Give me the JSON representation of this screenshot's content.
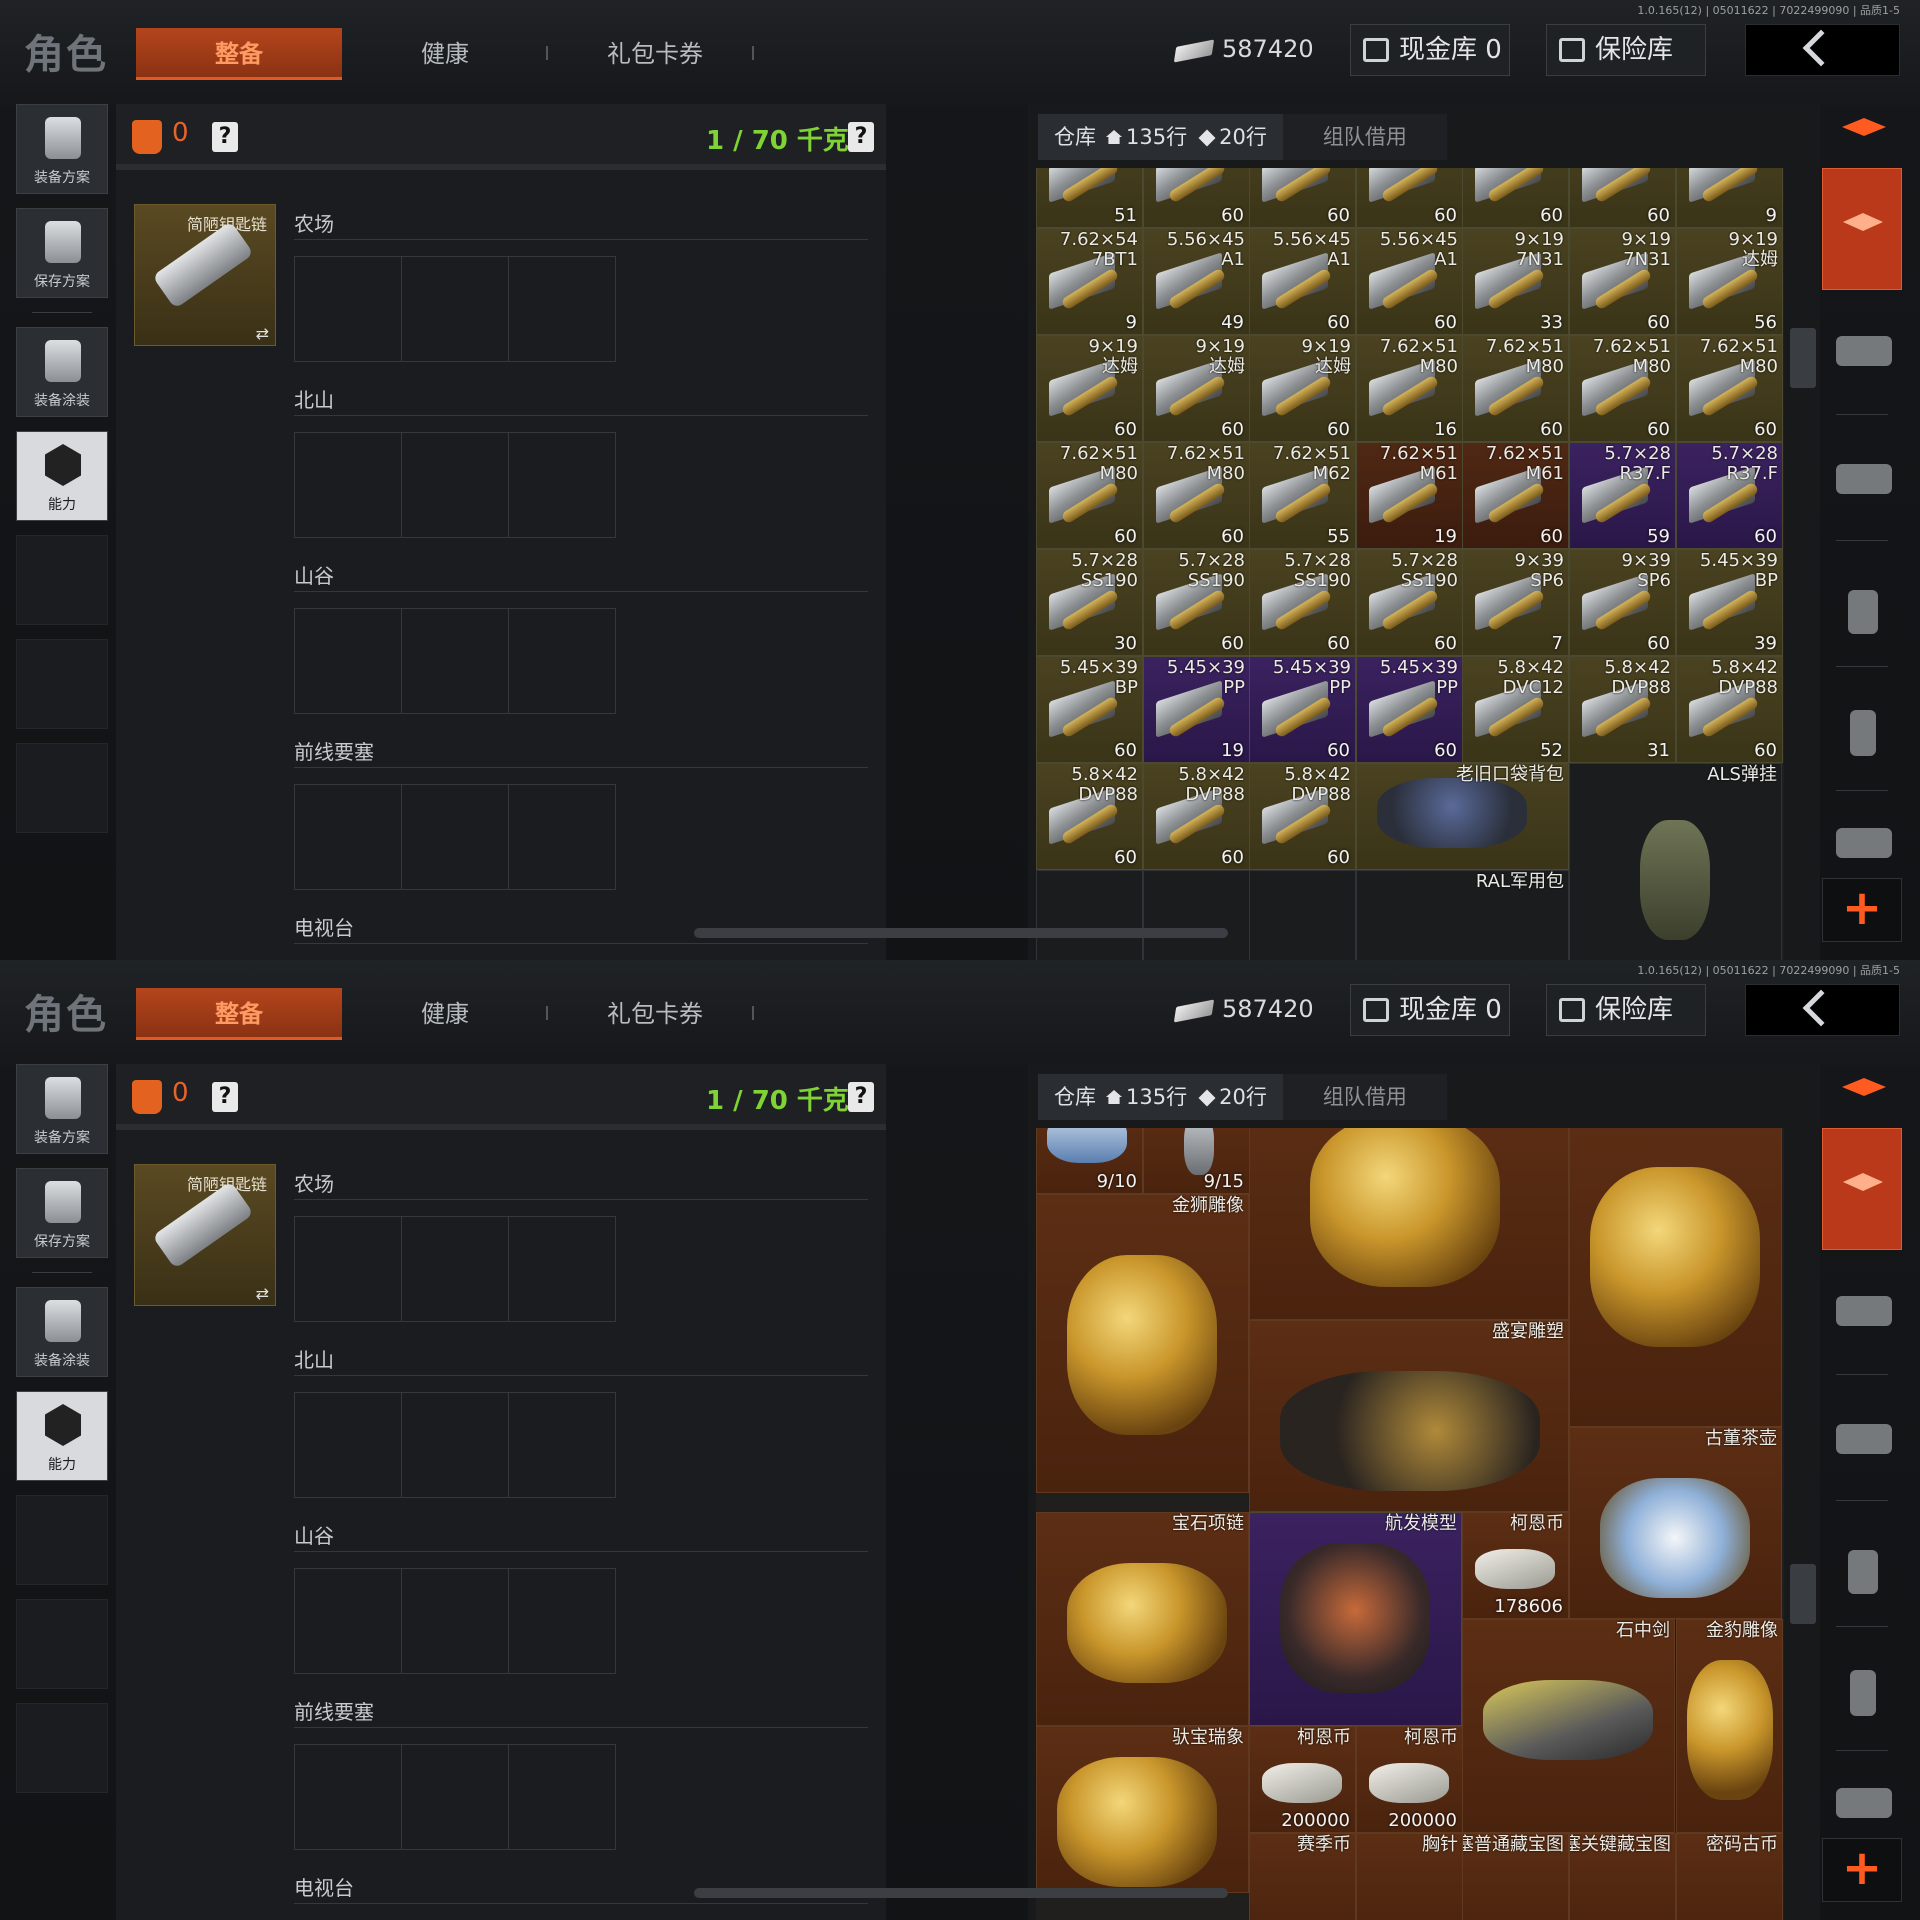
{
  "screens": [
    {
      "version": "1.0.165(12) | 05011622 | 7022499090 | 品质1-5",
      "header": {
        "title": "角色",
        "tabs": [
          "整备",
          "健康",
          "礼包卡券"
        ],
        "money": "587420",
        "cash_vault": "现金库 0",
        "vault": "保险库"
      },
      "left_sidebar": [
        "装备方案",
        "保存方案",
        "装备涂装",
        "能力"
      ],
      "loadout": {
        "armor_count": "0",
        "help": "?",
        "weight": "1 / 70 千克",
        "keychain_name": "简陋钥匙链",
        "sections": [
          "农场",
          "北山",
          "山谷",
          "前线要塞",
          "电视台"
        ]
      },
      "storage": {
        "tab_label": "仓库",
        "rows_home": "135行",
        "rows_gem": "20行",
        "team_tab": "组队借用",
        "cells": [
          {
            "name": "",
            "count": "51",
            "color": "g"
          },
          {
            "name": "",
            "count": "60",
            "color": "g"
          },
          {
            "name": "",
            "count": "60",
            "color": "g"
          },
          {
            "name": "",
            "count": "60",
            "color": "g"
          },
          {
            "name": "",
            "count": "60",
            "color": "g"
          },
          {
            "name": "",
            "count": "60",
            "color": "g"
          },
          {
            "name": "",
            "count": "9",
            "color": "g"
          },
          {
            "name": "7.62×54\n7BT1",
            "count": "9",
            "color": "g"
          },
          {
            "name": "5.56×45\nA1",
            "count": "49",
            "color": "g"
          },
          {
            "name": "5.56×45\nA1",
            "count": "60",
            "color": "g"
          },
          {
            "name": "5.56×45\nA1",
            "count": "60",
            "color": "g"
          },
          {
            "name": "9×19\n7N31",
            "count": "33",
            "color": "g"
          },
          {
            "name": "9×19\n7N31",
            "count": "60",
            "color": "g"
          },
          {
            "name": "9×19\n达姆",
            "count": "56",
            "color": "g"
          },
          {
            "name": "9×19\n达姆",
            "count": "60",
            "color": "g"
          },
          {
            "name": "9×19\n达姆",
            "count": "60",
            "color": "g"
          },
          {
            "name": "9×19\n达姆",
            "count": "60",
            "color": "g"
          },
          {
            "name": "7.62×51\nM80",
            "count": "16",
            "color": "g"
          },
          {
            "name": "7.62×51\nM80",
            "count": "60",
            "color": "g"
          },
          {
            "name": "7.62×51\nM80",
            "count": "60",
            "color": "g"
          },
          {
            "name": "7.62×51\nM80",
            "count": "60",
            "color": "g"
          },
          {
            "name": "7.62×51\nM80",
            "count": "60",
            "color": "g"
          },
          {
            "name": "7.62×51\nM80",
            "count": "60",
            "color": "g"
          },
          {
            "name": "7.62×51\nM62",
            "count": "55",
            "color": "g"
          },
          {
            "name": "7.62×51\nM61",
            "count": "19",
            "color": "r"
          },
          {
            "name": "7.62×51\nM61",
            "count": "60",
            "color": "r"
          },
          {
            "name": "5.7×28\nR37.F",
            "count": "59",
            "color": "p"
          },
          {
            "name": "5.7×28\nR37.F",
            "count": "60",
            "color": "p"
          },
          {
            "name": "5.7×28\nSS190",
            "count": "30",
            "color": "g"
          },
          {
            "name": "5.7×28\nSS190",
            "count": "60",
            "color": "g"
          },
          {
            "name": "5.7×28\nSS190",
            "count": "60",
            "color": "g"
          },
          {
            "name": "5.7×28\nSS190",
            "count": "60",
            "color": "g"
          },
          {
            "name": "9×39\nSP6",
            "count": "7",
            "color": "g"
          },
          {
            "name": "9×39\nSP6",
            "count": "60",
            "color": "g"
          },
          {
            "name": "5.45×39\nBP",
            "count": "39",
            "color": "g"
          },
          {
            "name": "5.45×39\nBP",
            "count": "60",
            "color": "g"
          },
          {
            "name": "5.45×39\nPP",
            "count": "19",
            "color": "p"
          },
          {
            "name": "5.45×39\nPP",
            "count": "60",
            "color": "p"
          },
          {
            "name": "5.45×39\nPP",
            "count": "60",
            "color": "p"
          },
          {
            "name": "5.8×42\nDVC12",
            "count": "52",
            "color": "g"
          },
          {
            "name": "5.8×42\nDVP88",
            "count": "31",
            "color": "g"
          },
          {
            "name": "5.8×42\nDVP88",
            "count": "60",
            "color": "g"
          },
          {
            "name": "5.8×42\nDVP88",
            "count": "60",
            "color": "g"
          },
          {
            "name": "5.8×42\nDVP88",
            "count": "60",
            "color": "g"
          },
          {
            "name": "5.8×42\nDVP88",
            "count": "60",
            "color": "g"
          },
          {
            "name": "老旧口袋背包",
            "count": "",
            "color": "g"
          },
          {
            "name": "ALS弹挂",
            "count": "",
            "color": "e"
          },
          {
            "name": "RAL军用包",
            "count": "",
            "color": "e"
          }
        ]
      }
    },
    {
      "version": "1.0.165(12) | 05011622 | 7022499090 | 品质1-5",
      "header": {
        "title": "角色",
        "tabs": [
          "整备",
          "健康",
          "礼包卡券"
        ],
        "money": "587420",
        "cash_vault": "现金库 0",
        "vault": "保险库"
      },
      "left_sidebar": [
        "装备方案",
        "保存方案",
        "装备涂装",
        "能力"
      ],
      "loadout": {
        "armor_count": "0",
        "help": "?",
        "weight": "1 / 70 千克",
        "keychain_name": "简陋钥匙链",
        "sections": [
          "农场",
          "北山",
          "山谷",
          "前线要塞",
          "电视台"
        ]
      },
      "storage": {
        "tab_label": "仓库",
        "rows_home": "135行",
        "rows_gem": "20行",
        "team_tab": "组队借用",
        "cells": [
          {
            "name": "",
            "count": "9/10",
            "color": "b"
          },
          {
            "name": "",
            "count": "9/15",
            "color": "b"
          },
          {
            "name": "",
            "count": "",
            "color": "b"
          },
          {
            "name": "",
            "count": "",
            "color": "b"
          },
          {
            "name": "金狮雕像",
            "count": "",
            "color": "b"
          },
          {
            "name": "盛宴雕塑",
            "count": "",
            "color": "b"
          },
          {
            "name": "古董茶壶",
            "count": "",
            "color": "b"
          },
          {
            "name": "宝石项链",
            "count": "",
            "color": "b"
          },
          {
            "name": "航发模型",
            "count": "",
            "color": "p"
          },
          {
            "name": "柯恩币",
            "count": "178606",
            "color": "b"
          },
          {
            "name": "石中剑",
            "count": "",
            "color": "b"
          },
          {
            "name": "金豹雕像",
            "count": "",
            "color": "b"
          },
          {
            "name": "驮宝瑞象",
            "count": "",
            "color": "b"
          },
          {
            "name": "柯恩币",
            "count": "200000",
            "color": "b"
          },
          {
            "name": "柯恩币",
            "count": "200000",
            "color": "b"
          },
          {
            "name": "赛季币",
            "count": "",
            "color": "b"
          },
          {
            "name": "胸针",
            "count": "",
            "color": "b"
          },
          {
            "name": "要塞普通藏宝图",
            "count": "",
            "color": "b"
          },
          {
            "name": "要塞关键藏宝图",
            "count": "",
            "color": "b"
          },
          {
            "name": "密码古币",
            "count": "",
            "color": "b"
          }
        ]
      }
    }
  ],
  "colors": {
    "accent": "#e15a22",
    "weight_green": "#7ed335",
    "gold_cell": "#4a4220",
    "red_cell": "#502814",
    "purple_cell": "#3b2260"
  },
  "icons": [
    "armor-vest-icon",
    "help-icon",
    "money-icon",
    "cash-vault-icon",
    "vault-icon",
    "back-chevron-icon",
    "home-icon",
    "gem-icon",
    "plus-icon",
    "switch-icon"
  ]
}
